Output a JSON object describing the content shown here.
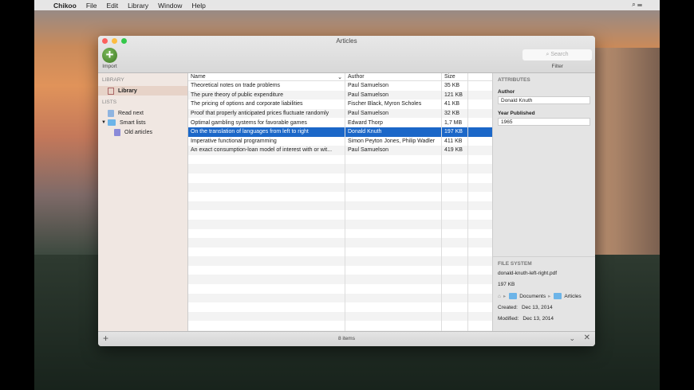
{
  "menubar": {
    "apple": "",
    "app": "Chikoo",
    "items": [
      "File",
      "Edit",
      "Library",
      "Window",
      "Help"
    ],
    "right": "⌕   ☰"
  },
  "window": {
    "title": "Articles",
    "import_label": "Import",
    "search_placeholder": "Search",
    "filter_label": "Filter"
  },
  "sidebar": {
    "library_header": "LIBRARY",
    "library_item": "Library",
    "lists_header": "LISTS",
    "items": [
      {
        "label": "Read next"
      },
      {
        "label": "Smart lists"
      },
      {
        "label": "Old articles"
      }
    ]
  },
  "table": {
    "columns": [
      "Name",
      "Author",
      "Size"
    ],
    "rows": [
      {
        "name": "Theoretical notes on trade problems",
        "author": "Paul Samuelson",
        "size": "35 KB"
      },
      {
        "name": "The pure theory of public expenditure",
        "author": "Paul Samuelson",
        "size": "121 KB"
      },
      {
        "name": "The pricing of options and corporate liabilities",
        "author": "Fischer Black, Myron Scholes",
        "size": "41 KB"
      },
      {
        "name": "Proof that properly anticipated prices fluctuate randomly",
        "author": "Paul Samuelson",
        "size": "32 KB"
      },
      {
        "name": "Optimal gambling systems for favorable games",
        "author": "Edward Thorp",
        "size": "1,7 MB"
      },
      {
        "name": "On the translation of languages from left to right",
        "author": "Donald Knuth",
        "size": "197 KB",
        "selected": true
      },
      {
        "name": "Imperative functional programming",
        "author": "Simon Peyton Jones, Philip Wadler",
        "size": "411 KB"
      },
      {
        "name": "An exact consumption-loan model of interest with or wit...",
        "author": "Paul Samuelson",
        "size": "419 KB"
      }
    ]
  },
  "attributes": {
    "header": "ATTRIBUTES",
    "author_label": "Author",
    "author_value": "Donald Knuth",
    "year_label": "Year Published",
    "year_value": "1965"
  },
  "filesystem": {
    "header": "FILE SYSTEM",
    "filename": "donald-knuth-left-right.pdf",
    "size": "197 KB",
    "path": [
      "Documents",
      "Articles"
    ],
    "created_label": "Created:",
    "created": "Dec 13, 2014",
    "modified_label": "Modified:",
    "modified": "Dec 13, 2014"
  },
  "status": {
    "count": "8 items",
    "add": "+"
  }
}
